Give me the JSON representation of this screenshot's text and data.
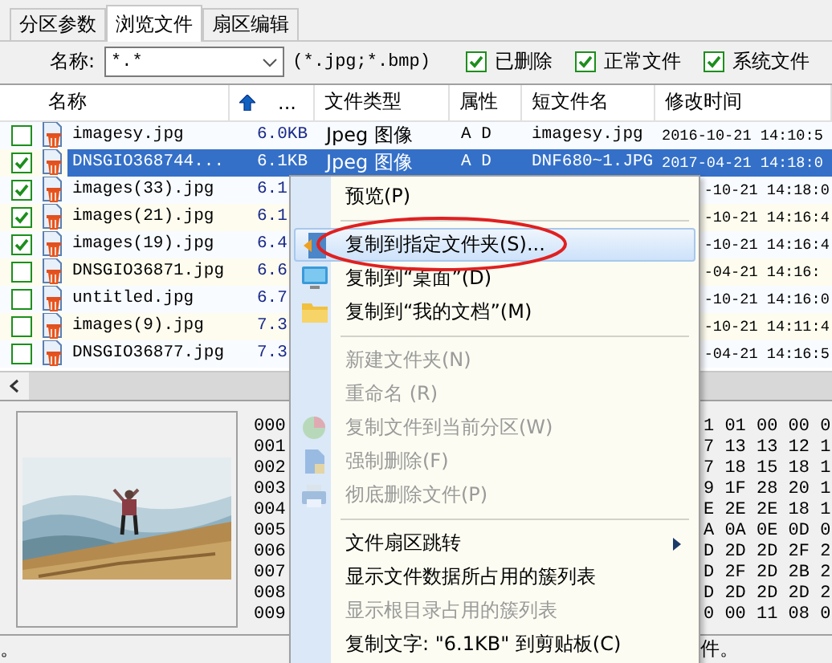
{
  "tabs": [
    {
      "label": "分区参数",
      "selected": false
    },
    {
      "label": "浏览文件",
      "selected": true
    },
    {
      "label": "扇区编辑",
      "selected": false
    }
  ],
  "filter": {
    "label": "名称:",
    "value": "*.*",
    "hint": "(*.jpg;*.bmp)",
    "options": [
      {
        "label": "已删除",
        "checked": true
      },
      {
        "label": "正常文件",
        "checked": true
      },
      {
        "label": "系统文件",
        "checked": true
      }
    ]
  },
  "table": {
    "columns": [
      {
        "label": "名称",
        "sorted": false
      },
      {
        "label": "...",
        "sorted": true
      },
      {
        "label": "文件类型",
        "sorted": false
      },
      {
        "label": "属性",
        "sorted": false
      },
      {
        "label": "短文件名",
        "sorted": false
      },
      {
        "label": "修改时间",
        "sorted": false
      }
    ],
    "rows": [
      {
        "kind": "full",
        "checked": false,
        "selected": false,
        "name": "imagesy.jpg",
        "size": "6.0KB",
        "type": "Jpeg 图像",
        "attr": "A D",
        "short_name": "imagesy.jpg",
        "modified": "2016-10-21 14:10:5"
      },
      {
        "kind": "full",
        "checked": true,
        "selected": true,
        "name": "DNSGIO368744...",
        "size": "6.1KB",
        "type": "Jpeg 图像",
        "attr": "A D",
        "short_name": "DNF680~1.JPG",
        "modified": "2017-04-21 14:18:0"
      },
      {
        "kind": "covered",
        "checked": true,
        "selected": false,
        "name": "images(33).jpg",
        "size": "6.1",
        "modified": "-10-21 14:18:0"
      },
      {
        "kind": "covered",
        "checked": true,
        "selected": false,
        "name": "images(21).jpg",
        "size": "6.1",
        "modified": "-10-21 14:16:4"
      },
      {
        "kind": "covered",
        "checked": true,
        "selected": false,
        "name": "images(19).jpg",
        "size": "6.4",
        "modified": "-10-21 14:16:4"
      },
      {
        "kind": "covered",
        "checked": false,
        "selected": false,
        "name": "DNSGIO36871.jpg",
        "size": "6.6",
        "modified": "-04-21 14:16:"
      },
      {
        "kind": "covered",
        "checked": false,
        "selected": false,
        "name": "untitled.jpg",
        "size": "6.7",
        "modified": "-10-21 14:16:0"
      },
      {
        "kind": "covered",
        "checked": false,
        "selected": false,
        "name": "images(9).jpg",
        "size": "7.3",
        "modified": "-10-21 14:11:4"
      },
      {
        "kind": "covered",
        "checked": false,
        "selected": false,
        "name": "DNSGIO36877.jpg",
        "size": "7.3",
        "modified": "-04-21 14:16:5"
      }
    ]
  },
  "hex": {
    "offsets": [
      "000",
      "001",
      "002",
      "003",
      "004",
      "005",
      "006",
      "007",
      "008",
      "009"
    ],
    "rows": [
      "1 01 00 00 0",
      "7 13 13 12 1",
      "7 18 15 18 1",
      "9 1F 28 20 1",
      "E 2E 2E 18 1",
      "A 0A 0E 0D 0",
      "D 2D 2D 2F 2",
      "D 2F 2D 2B 2",
      "D 2D 2D 2D 2",
      "0 00 11 08 0"
    ]
  },
  "status_bar": {
    "left": "。",
    "right": "件。"
  },
  "context_menu": {
    "items": [
      {
        "kind": "item",
        "label": "预览(P)",
        "disabled": false,
        "highlighted": false,
        "submenu": false
      },
      {
        "kind": "separator"
      },
      {
        "kind": "item",
        "label": "复制到指定文件夹(S)...",
        "disabled": false,
        "highlighted": true,
        "submenu": false
      },
      {
        "kind": "item",
        "label": "复制到“桌面”(D)",
        "disabled": false,
        "highlighted": false,
        "submenu": false
      },
      {
        "kind": "item",
        "label": "复制到“我的文档”(M)",
        "disabled": false,
        "highlighted": false,
        "submenu": false
      },
      {
        "kind": "separator"
      },
      {
        "kind": "item",
        "label": "新建文件夹(N)",
        "disabled": true,
        "highlighted": false,
        "submenu": false
      },
      {
        "kind": "item",
        "label": "重命名 (R)",
        "disabled": true,
        "highlighted": false,
        "submenu": false
      },
      {
        "kind": "item",
        "label": "复制文件到当前分区(W)",
        "disabled": true,
        "highlighted": false,
        "submenu": false
      },
      {
        "kind": "item",
        "label": "强制删除(F)",
        "disabled": true,
        "highlighted": false,
        "submenu": false
      },
      {
        "kind": "item",
        "label": "彻底删除文件(P)",
        "disabled": true,
        "highlighted": false,
        "submenu": false
      },
      {
        "kind": "separator"
      },
      {
        "kind": "item",
        "label": "文件扇区跳转",
        "disabled": false,
        "highlighted": false,
        "submenu": true
      },
      {
        "kind": "item",
        "label": "显示文件数据所占用的簇列表",
        "disabled": false,
        "highlighted": false,
        "submenu": false
      },
      {
        "kind": "item",
        "label": "显示根目录占用的簇列表",
        "disabled": true,
        "highlighted": false,
        "submenu": false
      },
      {
        "kind": "item",
        "label": "复制文字: \"6.1KB\" 到剪贴板(C)",
        "disabled": false,
        "highlighted": false,
        "submenu": false
      }
    ]
  }
}
